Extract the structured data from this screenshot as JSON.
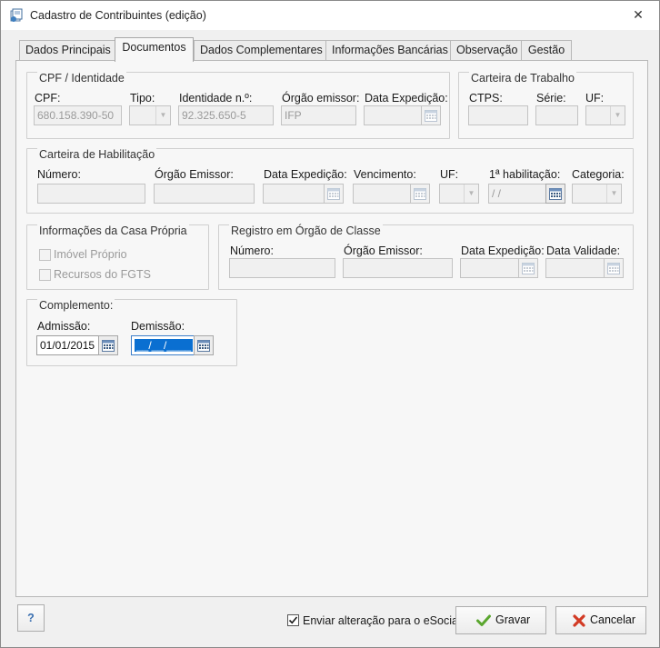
{
  "window": {
    "title": "Cadastro de Contribuintes (edição)"
  },
  "tabs": [
    "Dados Principais",
    "Documentos",
    "Dados Complementares",
    "Informações Bancárias",
    "Observação",
    "Gestão"
  ],
  "cpf_identidade": {
    "title": "CPF / Identidade",
    "cpf_label": "CPF:",
    "cpf_value": "680.158.390-50",
    "tipo_label": "Tipo:",
    "tipo_value": "",
    "identidade_label": "Identidade n.º:",
    "identidade_value": "92.325.650-5",
    "orgao_label": "Órgão emissor:",
    "orgao_value": "IFP",
    "expedicao_label": "Data Expedição:",
    "expedicao_value": ""
  },
  "carteira_trabalho": {
    "title": "Carteira de Trabalho",
    "ctps_label": "CTPS:",
    "serie_label": "Série:",
    "uf_label": "UF:"
  },
  "carteira_habilitacao": {
    "title": "Carteira de Habilitação",
    "numero_label": "Número:",
    "orgao_label": "Órgão Emissor:",
    "expedicao_label": "Data Expedição:",
    "vencimento_label": "Vencimento:",
    "uf_label": "UF:",
    "primeira_label": "1ª habilitação:",
    "primeira_value": " / /",
    "categoria_label": "Categoria:"
  },
  "casa_propria": {
    "title": "Informações da Casa Própria",
    "imovel_label": "Imóvel Próprio",
    "fgts_label": "Recursos do FGTS"
  },
  "orgao_classe": {
    "title": "Registro em Órgão de Classe",
    "numero_label": "Número:",
    "orgao_label": "Órgão Emissor:",
    "expedicao_label": "Data Expedição:",
    "validade_label": "Data Validade:"
  },
  "complemento": {
    "title": "Complemento:",
    "admissao_label": "Admissão:",
    "admissao_value": "01/01/2015",
    "demissao_label": "Demissão:",
    "demissao_value": "__/__/____"
  },
  "footer": {
    "help_label": "?",
    "esocial_label": "Enviar alteração para o eSocial",
    "esocial_checked": true,
    "gravar_label": "Gravar",
    "cancelar_label": "Cancelar"
  }
}
